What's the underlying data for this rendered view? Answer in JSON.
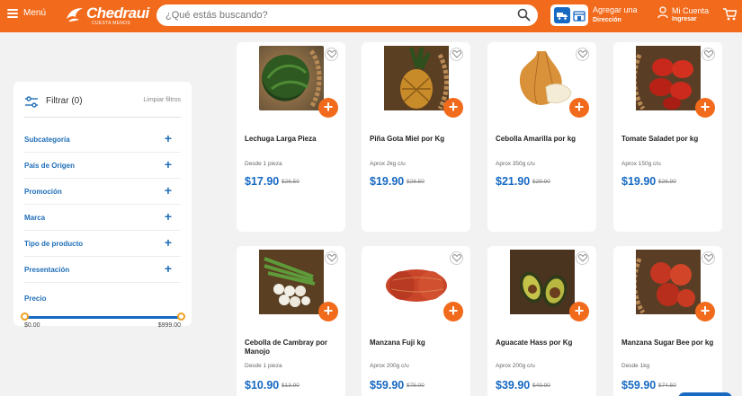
{
  "header": {
    "menu_label": "Menú",
    "brand_name": "Chedraui",
    "brand_tagline": "CUESTA MENOS",
    "search_placeholder": "¿Qué estás buscando?",
    "delivery_title": "Agregar una",
    "delivery_sub": "Dirección",
    "account_title": "Mi Cuenta",
    "account_sub": "Ingresar",
    "colors": {
      "brand_orange": "#f26a1b",
      "brand_blue": "#1769c2"
    }
  },
  "filters": {
    "title": "Filtrar (0)",
    "clear_label": "Limpiar filtros",
    "facets": [
      {
        "label": "Subcategoría"
      },
      {
        "label": "País de Origen"
      },
      {
        "label": "Promoción"
      },
      {
        "label": "Marca"
      },
      {
        "label": "Tipo de producto"
      },
      {
        "label": "Presentación"
      }
    ],
    "price_label": "Precio",
    "price_min": "$0.00",
    "price_max": "$999.00"
  },
  "products": [
    {
      "name": "Lechuga Larga Pieza",
      "desc": "Desde 1 pieza",
      "price": "$17.90",
      "old_price": "$26.50",
      "icon": "lettuce"
    },
    {
      "name": "Piña Gota Miel por Kg",
      "desc": "Aprox 2kg c/u",
      "price": "$19.90",
      "old_price": "$28.50",
      "icon": "pineapple"
    },
    {
      "name": "Cebolla Amarilla por kg",
      "desc": "Aprox 350g c/u",
      "price": "$21.90",
      "old_price": "$29.90",
      "icon": "onion"
    },
    {
      "name": "Tomate Saladet por kg",
      "desc": "Aprox 150g c/u",
      "price": "$19.90",
      "old_price": "$26.90",
      "icon": "tomato"
    },
    {
      "name": "Cebolla de Cambray por Manojo",
      "desc": "Desde 1 pieza",
      "price": "$10.90",
      "old_price": "$13.90",
      "icon": "spring-onion"
    },
    {
      "name": "Manzana Fuji kg",
      "desc": "Aprox 200g c/u",
      "price": "$59.90",
      "old_price": "$75.00",
      "icon": "apple-fuji"
    },
    {
      "name": "Aguacate Hass por Kg",
      "desc": "Aprox 200g c/u",
      "price": "$39.90",
      "old_price": "$49.90",
      "icon": "avocado"
    },
    {
      "name": "Manzana Sugar Bee por kg",
      "desc": "Desde 1kg",
      "price": "$59.90",
      "old_price": "$74.50",
      "icon": "apple-sugarbee"
    }
  ]
}
